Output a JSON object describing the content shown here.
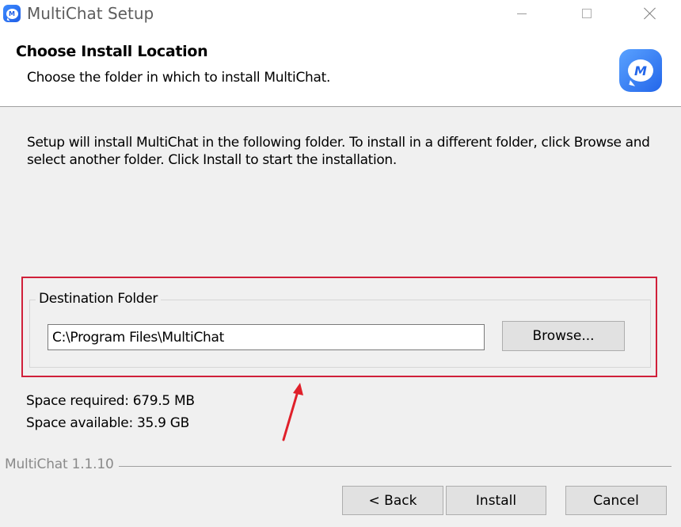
{
  "window": {
    "title": "MultiChat Setup",
    "icon": "multichat-app-icon",
    "icon_letter": "M"
  },
  "header": {
    "title": "Choose Install Location",
    "subtitle": "Choose the folder in which to install MultiChat.",
    "logo_letter": "M"
  },
  "body": {
    "description": "Setup will install MultiChat in the following folder. To install in a different folder, click Browse and select another folder. Click Install to start the installation.",
    "destination_group_label": "Destination Folder",
    "destination_path": "C:\\Program Files\\MultiChat",
    "browse_label": "Browse...",
    "space_required": "Space required: 679.5 MB",
    "space_available": "Space available: 35.9 GB"
  },
  "footer": {
    "version": "MultiChat 1.1.10",
    "back_label": "< Back",
    "install_label": "Install",
    "cancel_label": "Cancel"
  },
  "annotation": {
    "highlight_color": "#d0203a",
    "arrow_color": "#e0202a"
  }
}
